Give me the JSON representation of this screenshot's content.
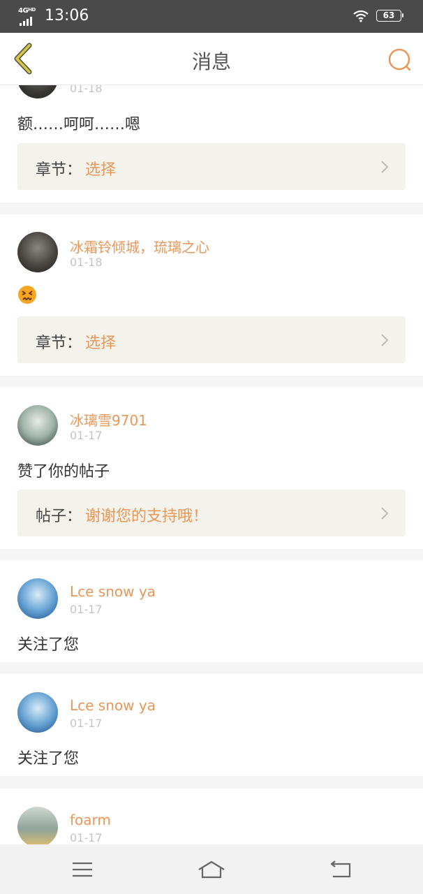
{
  "status_bar": {
    "network": "4G",
    "network_sup": "HD",
    "time": "13:06",
    "battery": "63"
  },
  "header": {
    "title": "消息",
    "back_icon": "chevron-left-icon",
    "search_icon": "search-icon"
  },
  "colors": {
    "accent": "#e8975a",
    "back_icon": "#d4c44a",
    "text": "#333333",
    "date": "#c4c4c4",
    "ref_bg": "#f3f3ec"
  },
  "messages": [
    {
      "date": "01-18",
      "text": "额……呵呵……嗯",
      "ref_label": "章节：",
      "ref_value": "选择"
    },
    {
      "user": "冰霜铃倾城，琉璃之心",
      "date": "01-18",
      "emoji": "confounded-face-emoji",
      "ref_label": "章节：",
      "ref_value": "选择"
    },
    {
      "user": "冰璃雪9701",
      "date": "01-17",
      "text": "赞了你的帖子",
      "ref_label": "帖子：",
      "ref_value": "谢谢您的支持哦！"
    },
    {
      "user": "Lce snow ya",
      "date": "01-17",
      "text": "关注了您"
    },
    {
      "user": "Lce snow ya",
      "date": "01-17",
      "text": "关注了您"
    },
    {
      "user": "foarm",
      "date": "01-17"
    }
  ],
  "nav_bar": {
    "menu_icon": "menu-icon",
    "home_icon": "home-icon",
    "back_icon": "return-icon"
  }
}
